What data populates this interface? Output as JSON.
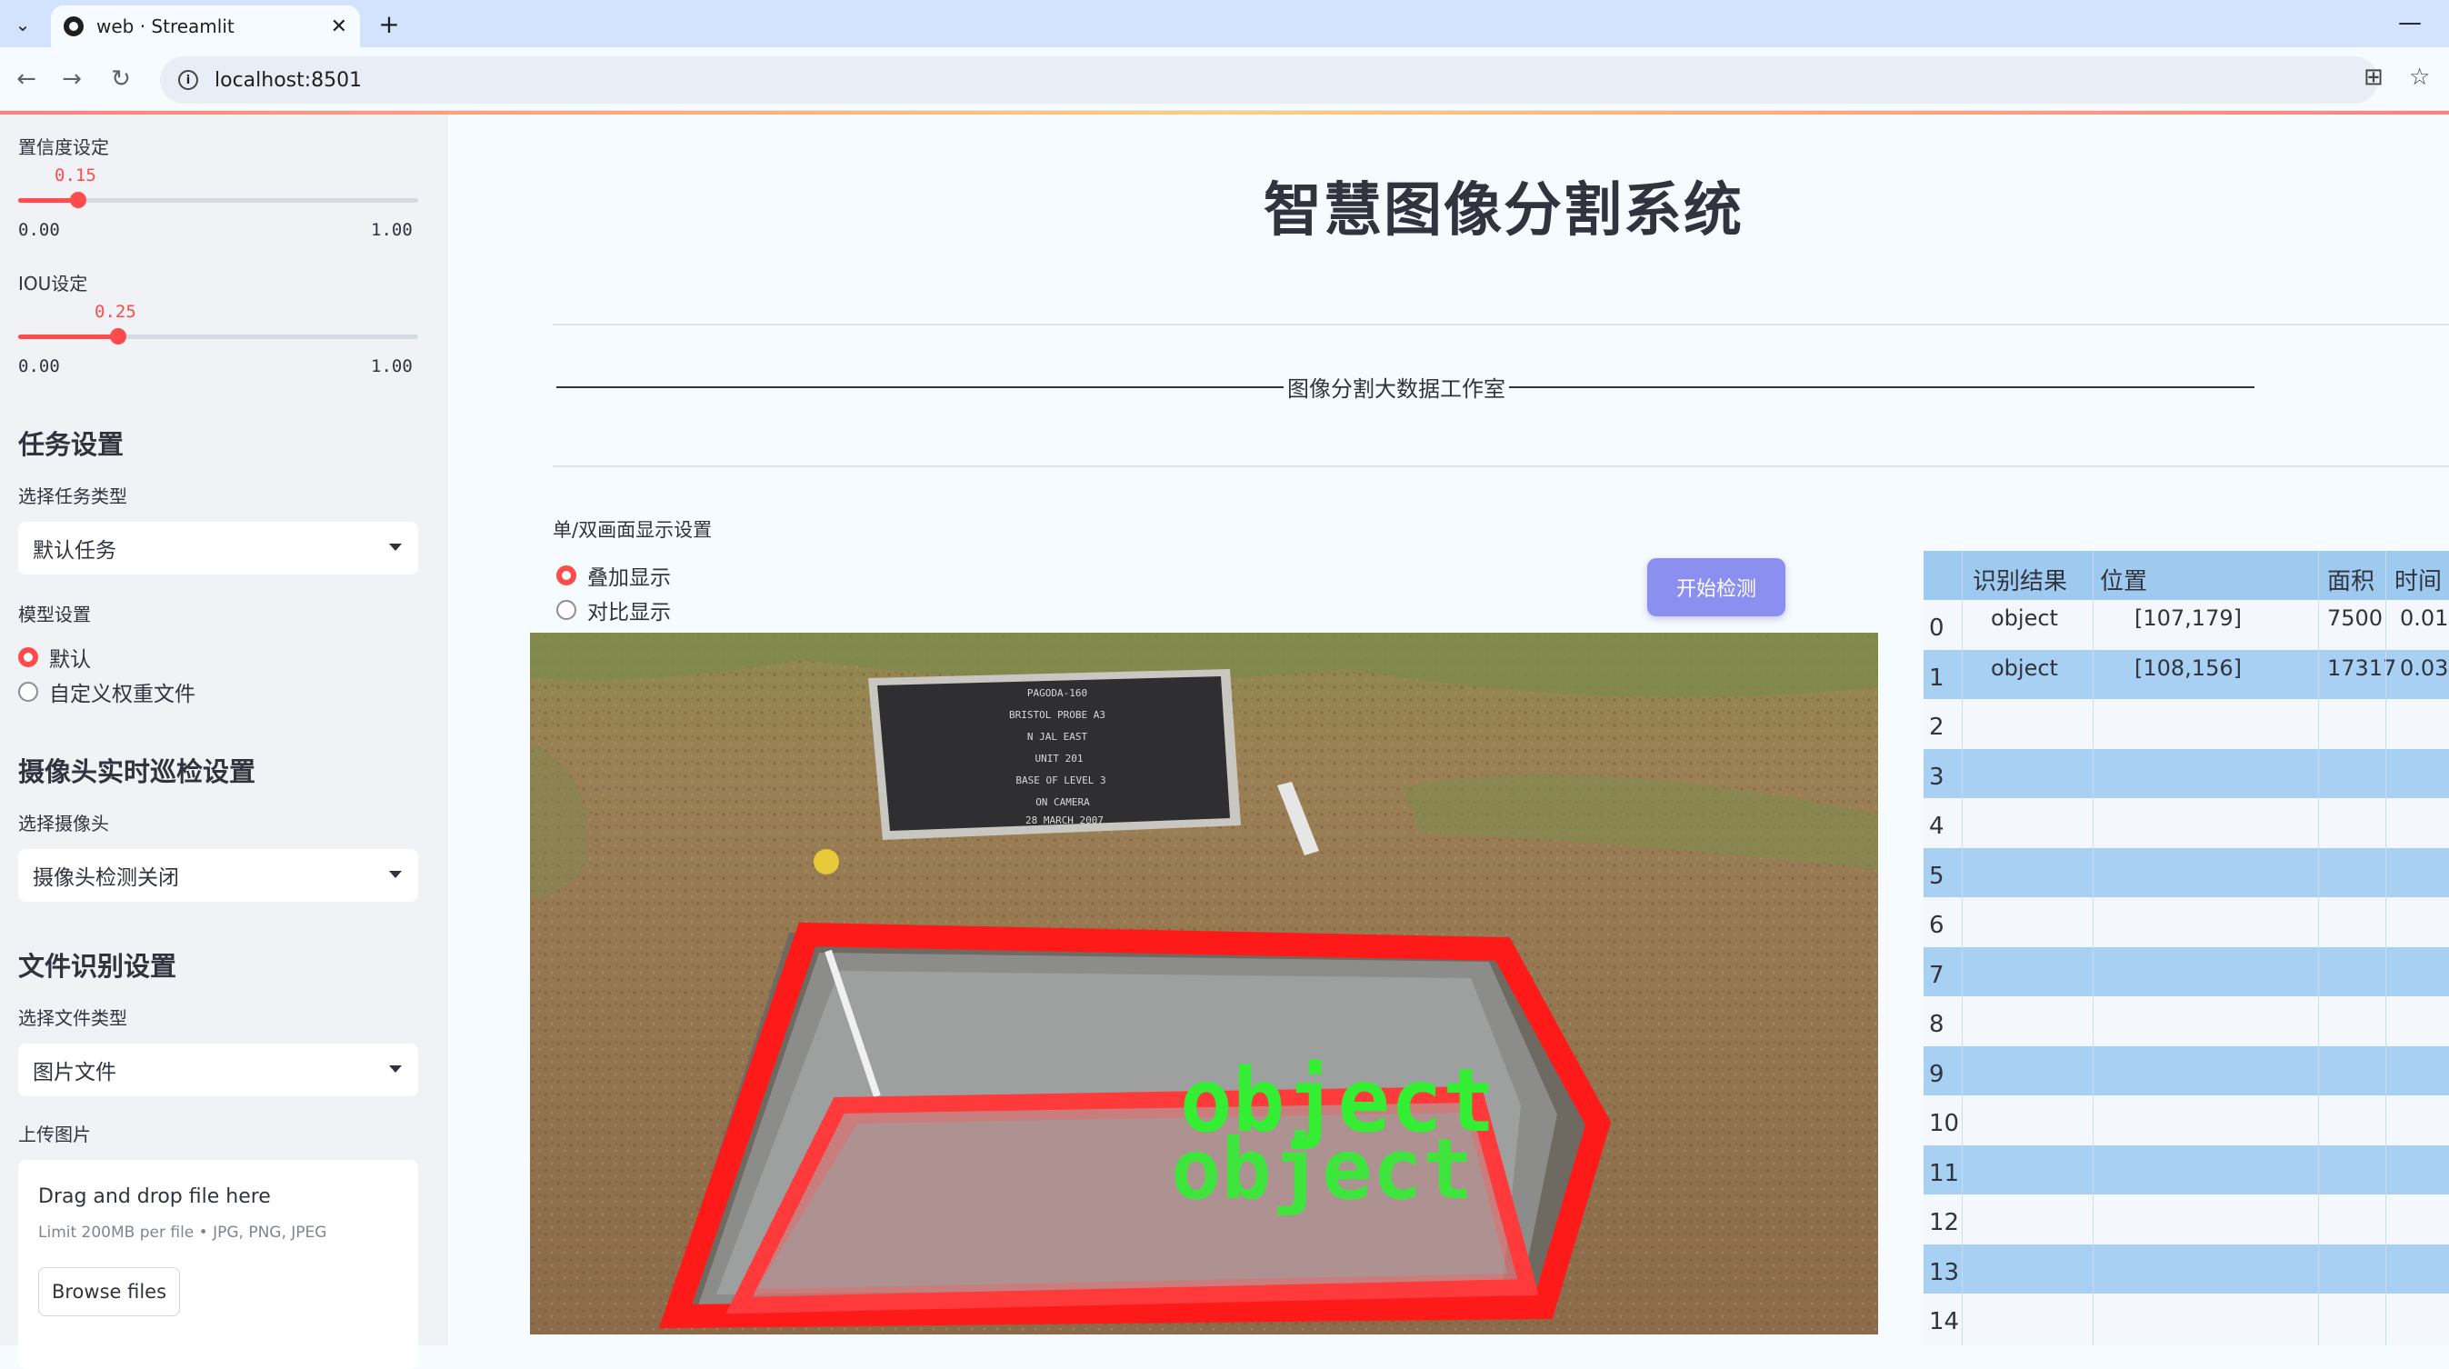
{
  "browser": {
    "tab_title": "web · Streamlit",
    "url": "localhost:8501"
  },
  "sidebar": {
    "confidence": {
      "label": "置信度设定",
      "value": "0.15",
      "min": "0.00",
      "max": "1.00",
      "fraction": 0.15
    },
    "iou": {
      "label": "IOU设定",
      "value": "0.25",
      "min": "0.00",
      "max": "1.00",
      "fraction": 0.25
    },
    "task_heading": "任务设置",
    "task_type_label": "选择任务类型",
    "task_type_value": "默认任务",
    "model_label": "模型设置",
    "model_options": [
      "默认",
      "自定义权重文件"
    ],
    "camera_heading": "摄像头实时巡检设置",
    "camera_label": "选择摄像头",
    "camera_value": "摄像头检测关闭",
    "file_heading": "文件识别设置",
    "file_type_label": "选择文件类型",
    "file_type_value": "图片文件",
    "upload_label": "上传图片",
    "upload_title": "Drag and drop file here",
    "upload_sub": "Limit 200MB per file • JPG, PNG, JPEG",
    "browse_label": "Browse files"
  },
  "main": {
    "title": "智慧图像分割系统",
    "subtitle": "图像分割大数据工作室",
    "display_mode_label": "单/双画面显示设置",
    "display_options": [
      "叠加显示",
      "对比显示"
    ],
    "start_button": "开始检测",
    "image": {
      "sign_lines": [
        "PAGODA-160",
        "BRISTOL PROBE A3",
        "N JAL EAST",
        "UNIT 201",
        "BASE OF LEVEL 3",
        "ON CAMERA",
        "28 MARCH 2007"
      ],
      "detections": [
        "object",
        "object"
      ]
    }
  },
  "table": {
    "headers": [
      "",
      "识别结果",
      "位置",
      "面积",
      "时间"
    ],
    "rows": [
      [
        "0",
        "object",
        "[107,179]",
        "7500",
        "0.01"
      ],
      [
        "1",
        "object",
        "[108,156]",
        "17317",
        "0.03"
      ],
      [
        "2",
        "",
        "",
        "",
        ""
      ],
      [
        "3",
        "",
        "",
        "",
        ""
      ],
      [
        "4",
        "",
        "",
        "",
        ""
      ],
      [
        "5",
        "",
        "",
        "",
        ""
      ],
      [
        "6",
        "",
        "",
        "",
        ""
      ],
      [
        "7",
        "",
        "",
        "",
        ""
      ],
      [
        "8",
        "",
        "",
        "",
        ""
      ],
      [
        "9",
        "",
        "",
        "",
        ""
      ],
      [
        "10",
        "",
        "",
        "",
        ""
      ],
      [
        "11",
        "",
        "",
        "",
        ""
      ],
      [
        "12",
        "",
        "",
        "",
        ""
      ],
      [
        "13",
        "",
        "",
        "",
        ""
      ],
      [
        "14",
        "",
        "",
        "",
        ""
      ]
    ]
  },
  "colors": {
    "accent": "#ff4b4b",
    "button": "#8b8ff0",
    "table_header": "#9fcaef",
    "detect_red": "#ff1a1a",
    "detect_green": "#33ee33"
  }
}
